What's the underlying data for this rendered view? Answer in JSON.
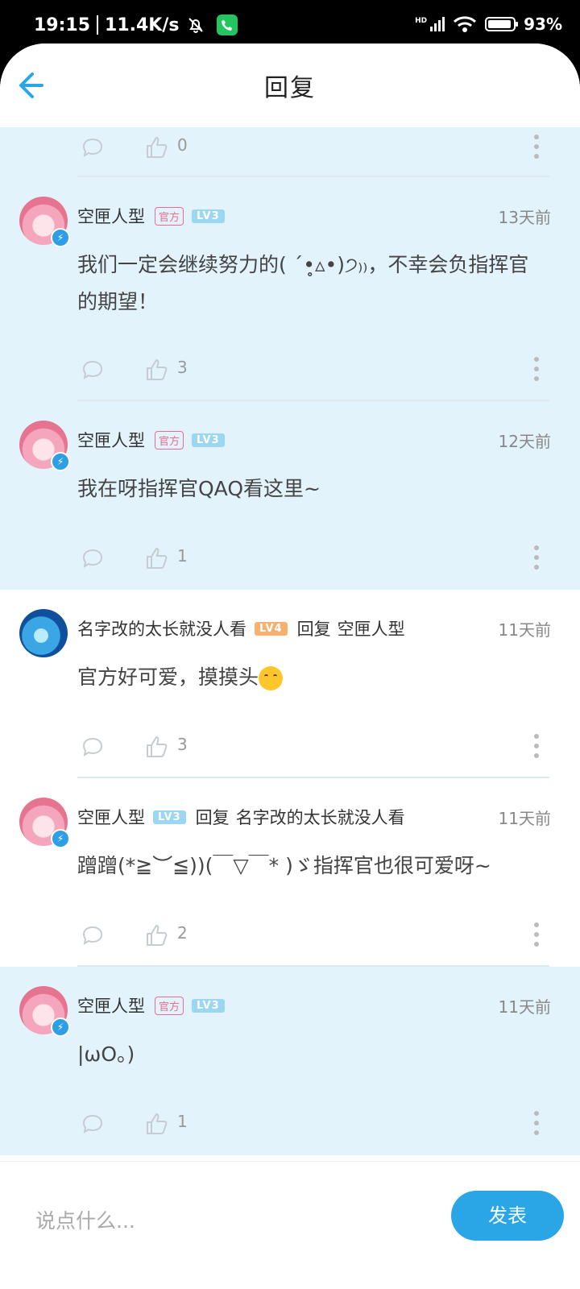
{
  "status_bar": {
    "time": "19:15",
    "net_speed": "11.4K/s",
    "signal_label": "HD",
    "battery": "93%"
  },
  "header": {
    "title": "回复"
  },
  "comments": [
    {
      "user": "空匣人型",
      "official": "官方",
      "level": "LV3",
      "time": "13天前",
      "text": "我们一定会继续努力的( ˊ•̥▵•)੭₎₎，不幸会负指挥官的期望！",
      "likes": "3",
      "avatar": "pink",
      "highlighted": true
    },
    {
      "user": "空匣人型",
      "official": "官方",
      "level": "LV3",
      "time": "12天前",
      "text": "我在呀指挥官QAQ看这里~",
      "likes": "1",
      "avatar": "pink",
      "highlighted": true
    },
    {
      "user": "名字改的太长就没人看",
      "level": "LV4",
      "reply_word": "回复",
      "reply_target": "空匣人型",
      "time": "11天前",
      "text": "官方好可爱，摸摸头",
      "likes": "3",
      "avatar": "blue",
      "highlighted": false
    },
    {
      "user": "空匣人型",
      "level": "LV3",
      "reply_word": "回复",
      "reply_target": "名字改的太长就没人看",
      "time": "11天前",
      "text": "蹭蹭(*≧︶≦))(￣▽￣* )ゞ指挥官也很可爱呀~",
      "likes": "2",
      "avatar": "pink",
      "highlighted": false
    },
    {
      "user": "空匣人型",
      "official": "官方",
      "level": "LV3",
      "time": "11天前",
      "text": "|ωO。)",
      "likes": "1",
      "avatar": "pink",
      "highlighted": true
    }
  ],
  "previous_likes": "0",
  "input": {
    "placeholder": "说点什么...",
    "send_label": "发表"
  },
  "colors": {
    "accent": "#2aa6e6",
    "highlight_bg": "#e3f3fc",
    "official_tag": "#ef6a8d"
  }
}
